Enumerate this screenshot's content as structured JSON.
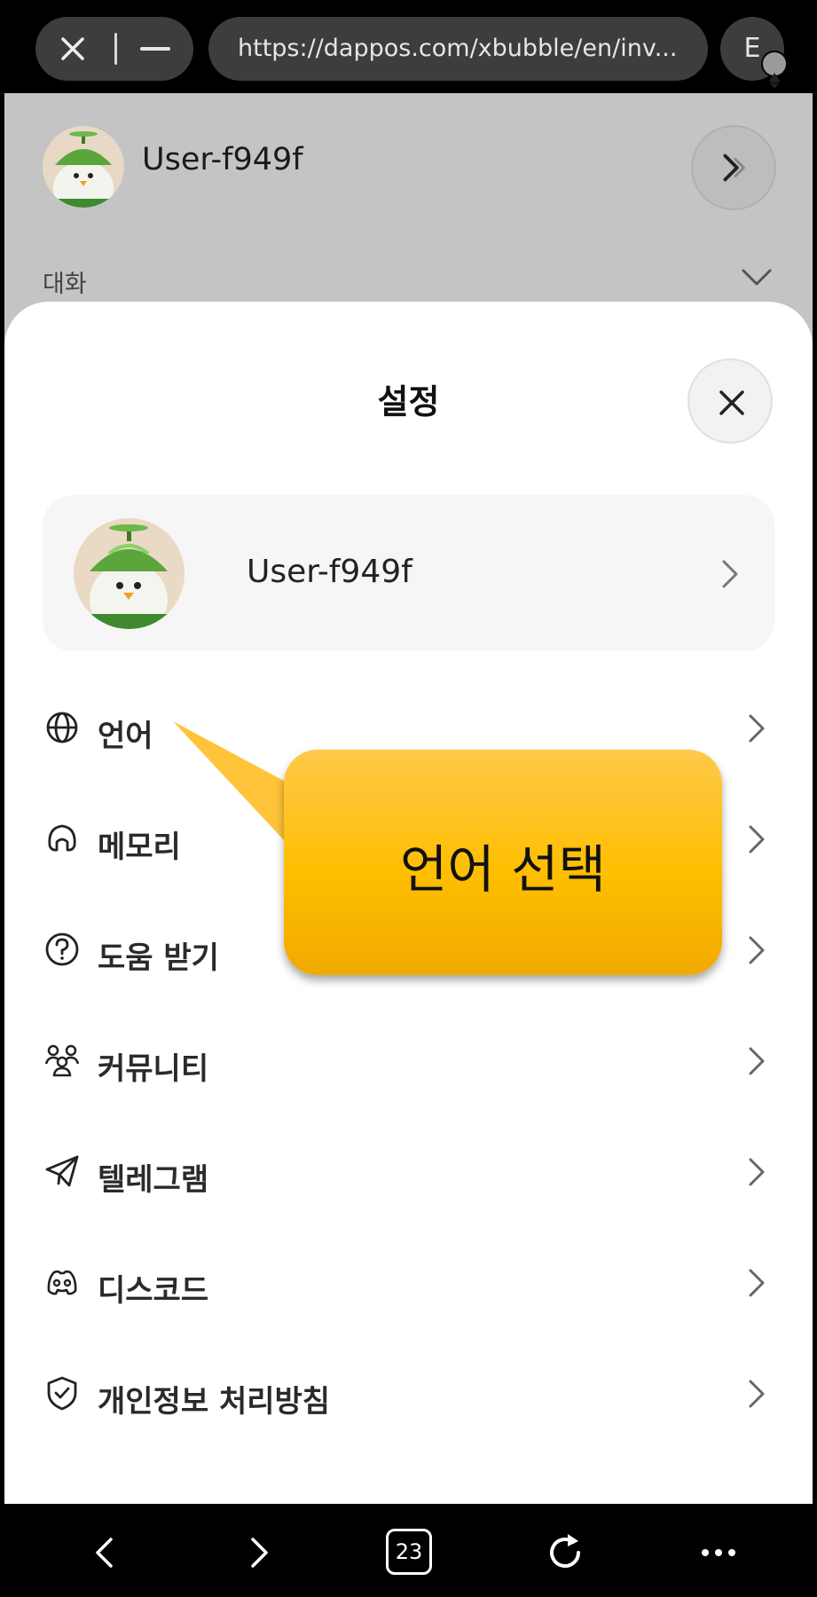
{
  "browser": {
    "url": "https://dappos.com/xbubble/en/inv...",
    "extension_label": "E",
    "tab_count": "23"
  },
  "background_page": {
    "username": "User-f949f",
    "section_label": "대화"
  },
  "settings": {
    "title": "설정",
    "profile_name": "User-f949f",
    "items": [
      {
        "label": "언어",
        "icon": "globe-icon"
      },
      {
        "label": "메모리",
        "icon": "brain-icon"
      },
      {
        "label": "도움 받기",
        "icon": "help-circle-icon"
      },
      {
        "label": "커뮤니티",
        "icon": "community-icon"
      },
      {
        "label": "텔레그램",
        "icon": "telegram-icon"
      },
      {
        "label": "디스코드",
        "icon": "discord-icon"
      },
      {
        "label": "개인정보 처리방침",
        "icon": "shield-check-icon"
      }
    ]
  },
  "callout": {
    "text": "언어 선택",
    "color": "#FFC000"
  }
}
